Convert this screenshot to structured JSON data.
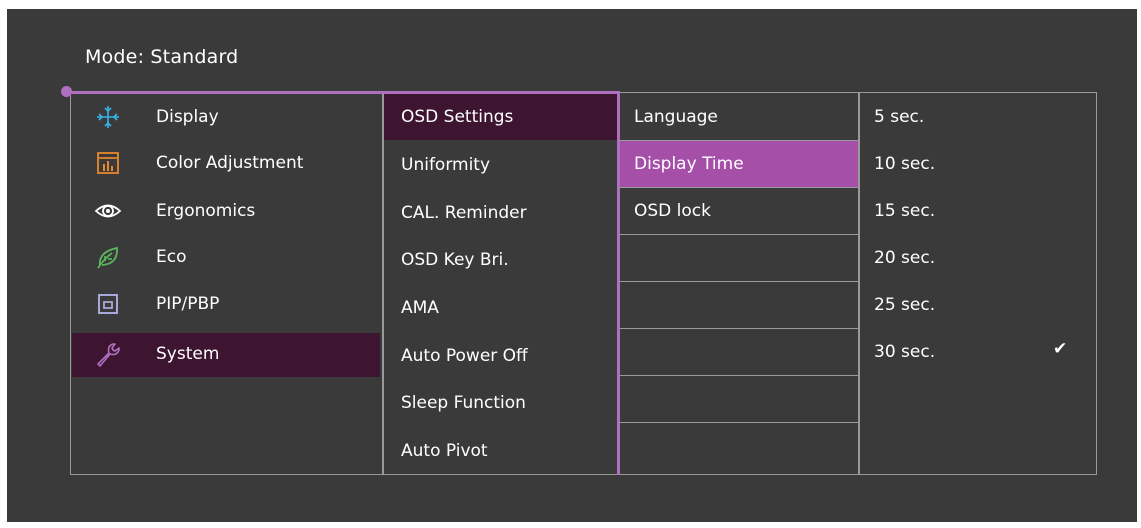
{
  "mode": {
    "label": "Mode: Standard"
  },
  "menu_main": [
    {
      "label": "Display",
      "icon": "display-icon",
      "selected": false
    },
    {
      "label": "Color Adjustment",
      "icon": "color-adjustment-icon",
      "selected": false
    },
    {
      "label": "Ergonomics",
      "icon": "eye-icon",
      "selected": false
    },
    {
      "label": "Eco",
      "icon": "leaf-icon",
      "selected": false
    },
    {
      "label": "PIP/PBP",
      "icon": "pip-icon",
      "selected": false
    },
    {
      "label": "System",
      "icon": "wrench-icon",
      "selected": true
    }
  ],
  "menu_system": [
    {
      "label": "OSD Settings",
      "active": true
    },
    {
      "label": "Uniformity"
    },
    {
      "label": "CAL. Reminder"
    },
    {
      "label": "OSD Key Bri."
    },
    {
      "label": "AMA"
    },
    {
      "label": "Auto Power Off"
    },
    {
      "label": "Sleep Function"
    },
    {
      "label": "Auto Pivot"
    }
  ],
  "menu_osd": [
    {
      "label": "Language"
    },
    {
      "label": "Display Time",
      "selected": true
    },
    {
      "label": "OSD lock"
    },
    {
      "label": ""
    },
    {
      "label": ""
    },
    {
      "label": ""
    },
    {
      "label": ""
    },
    {
      "label": ""
    }
  ],
  "display_time_options": [
    {
      "label": "5 sec."
    },
    {
      "label": "10 sec."
    },
    {
      "label": "15 sec."
    },
    {
      "label": "20 sec."
    },
    {
      "label": "25 sec."
    },
    {
      "label": "30 sec.",
      "checked": true,
      "check_glyph": "✔"
    }
  ],
  "colors": {
    "background": "#3a3a3a",
    "accent": "#b070c0",
    "selected_row": "#3d1530",
    "highlight": "#a54fa8",
    "icon_cyan": "#35b4e8",
    "icon_orange": "#e8872c",
    "icon_green": "#5cb85c",
    "icon_lavender": "#a8a8d8",
    "icon_purple": "#b070c0"
  }
}
